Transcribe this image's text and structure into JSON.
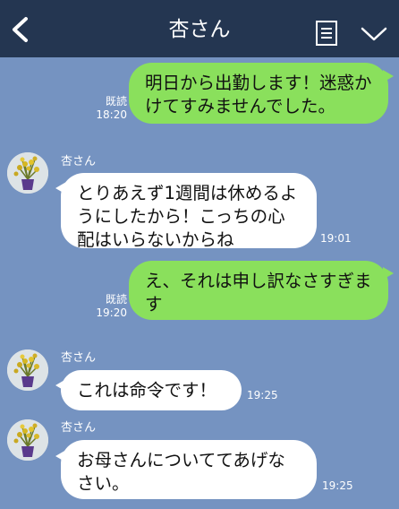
{
  "header": {
    "title": "杏さん"
  },
  "messages": [
    {
      "sender": "me",
      "text": "明日から出勤します！迷惑かけてすみませんでした。",
      "read": "既読",
      "time": "18:20"
    },
    {
      "sender": "other",
      "name": "杏さん",
      "text": "とりあえず1週間は休めるようにしたから！こっちの心配はいらないからね",
      "time": "19:01"
    },
    {
      "sender": "me",
      "text": "え、それは申し訳なさすぎます",
      "read": "既読",
      "time": "19:20"
    },
    {
      "sender": "other",
      "name": "杏さん",
      "text": "これは命令です！",
      "time": "19:25"
    },
    {
      "sender": "other",
      "name": "杏さん",
      "text": "お母さんについててあげなさい。",
      "time": "19:25"
    }
  ],
  "colors": {
    "header": "#243651",
    "background": "#7593c1",
    "sent_bubble": "#8ae05c",
    "received_bubble": "#ffffff"
  },
  "icons": {
    "back": "chevron-left-icon",
    "memo": "memo-icon",
    "menu": "chevron-down-icon"
  }
}
